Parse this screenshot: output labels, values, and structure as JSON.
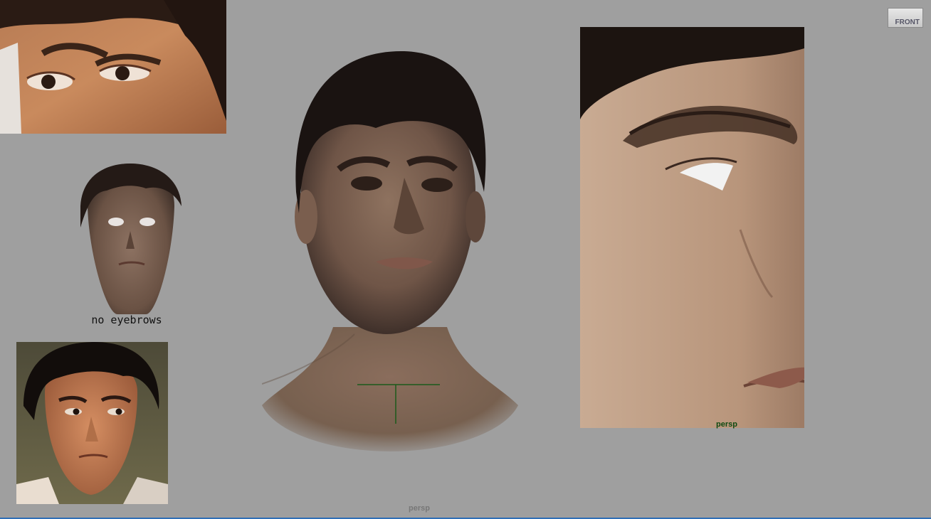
{
  "viewport": {
    "camera_label": "persp",
    "view_cube_label": "FRONT"
  },
  "panels": {
    "no_eyebrows_caption": "no eyebrows",
    "profile_camera_label": "persp"
  },
  "colors": {
    "background": "#9f9f9f",
    "viewport_border": "#2f6fb7",
    "profile_label": "#0f4a12"
  },
  "icons": {
    "view_cube": "view-cube-icon",
    "manipulator": "move-manipulator-icon"
  }
}
